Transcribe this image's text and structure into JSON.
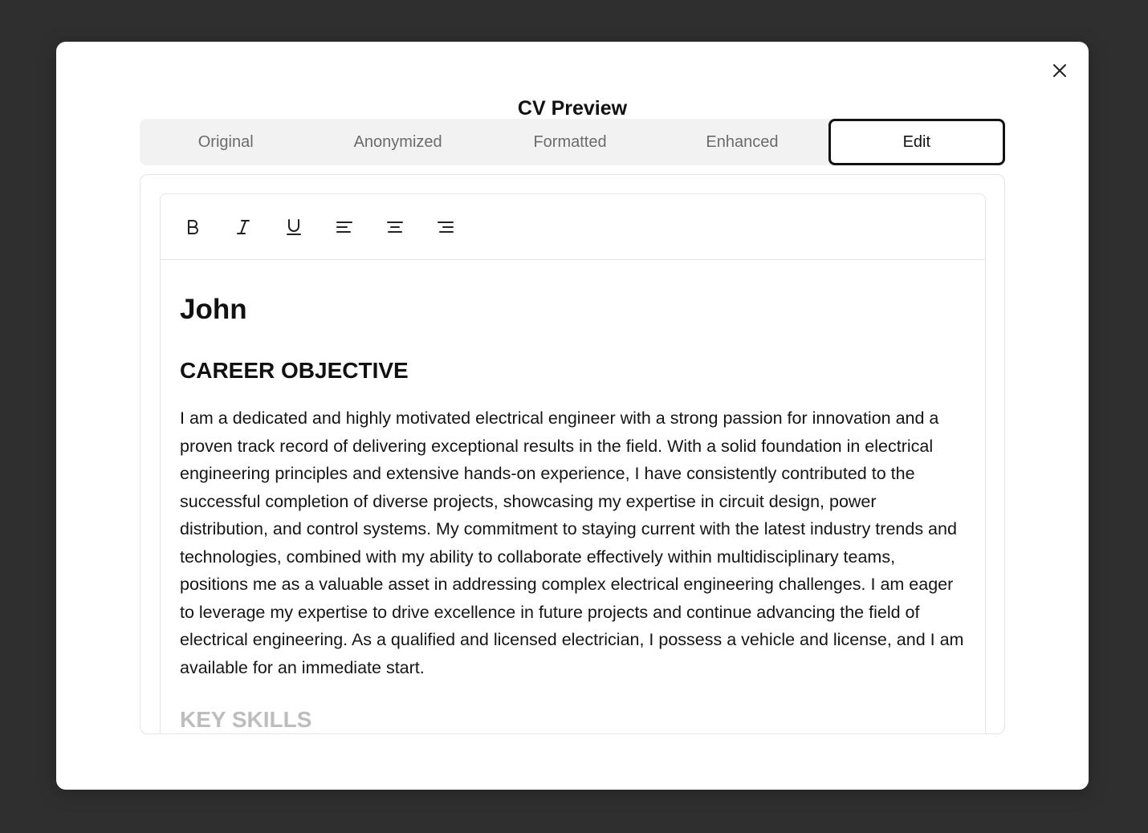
{
  "modal": {
    "title": "CV Preview",
    "close_icon": "close-icon"
  },
  "tabs": [
    {
      "label": "Original",
      "active": false
    },
    {
      "label": "Anonymized",
      "active": false
    },
    {
      "label": "Formatted",
      "active": false
    },
    {
      "label": "Enhanced",
      "active": false
    },
    {
      "label": "Edit",
      "active": true
    }
  ],
  "toolbar": {
    "buttons": [
      {
        "icon": "bold-icon"
      },
      {
        "icon": "italic-icon"
      },
      {
        "icon": "underline-icon"
      },
      {
        "icon": "align-left-icon"
      },
      {
        "icon": "align-center-icon"
      },
      {
        "icon": "align-right-icon"
      }
    ]
  },
  "document": {
    "name": "John",
    "sections": [
      {
        "heading": "CAREER OBJECTIVE",
        "body": "I am a dedicated and highly motivated electrical engineer with a strong passion for innovation and a proven track record of delivering exceptional results in the field. With a solid foundation in electrical engineering principles and extensive hands-on experience, I have consistently contributed to the successful completion of diverse projects, showcasing my expertise in circuit design, power distribution, and control systems. My commitment to staying current with the latest industry trends and technologies, combined with my ability to collaborate effectively within multidisciplinary teams, positions me as a valuable asset in addressing complex electrical engineering challenges. I am eager to leverage my expertise to drive excellence in future projects and continue advancing the field of electrical engineering. As a qualified and licensed electrician, I possess a vehicle and license, and I am available for an immediate start."
      },
      {
        "heading": "KEY SKILLS",
        "body": ""
      }
    ]
  },
  "colors": {
    "backdrop": "#2f2f2f",
    "modal_bg": "#ffffff",
    "tabs_bg": "#f2f2f2",
    "active_tab_border": "#111111",
    "inactive_tab_text": "#6b6b6b"
  }
}
